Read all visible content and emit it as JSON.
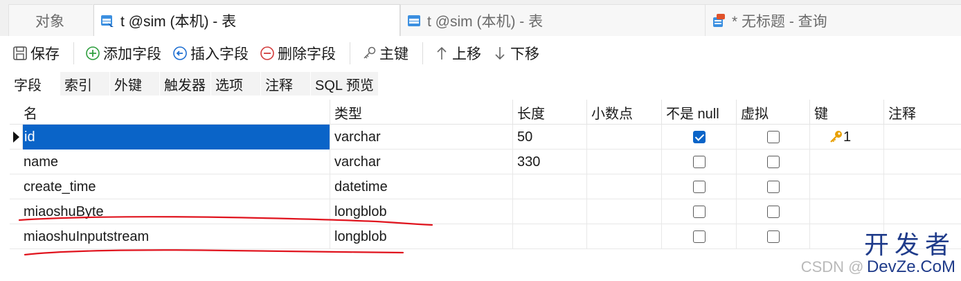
{
  "doc_tabs": {
    "objects_label": "对象",
    "tabs": [
      {
        "label": "t @sim (本机) - 表"
      },
      {
        "label": "t @sim (本机) - 表"
      },
      {
        "label": "* 无标题 - 查询"
      }
    ]
  },
  "toolbar": {
    "save": "保存",
    "add_field": "添加字段",
    "insert_field": "插入字段",
    "delete_field": "删除字段",
    "primary_key": "主键",
    "move_up": "上移",
    "move_down": "下移"
  },
  "sub_tabs": [
    "字段",
    "索引",
    "外键",
    "触发器",
    "选项",
    "注释",
    "SQL 预览"
  ],
  "grid": {
    "columns": [
      "名",
      "类型",
      "长度",
      "小数点",
      "不是 null",
      "虚拟",
      "键",
      "注释"
    ],
    "rows": [
      {
        "name": "id",
        "type": "varchar",
        "length": "50",
        "decimal": "",
        "not_null": true,
        "virtual": false,
        "key": "1",
        "comment": ""
      },
      {
        "name": "name",
        "type": "varchar",
        "length": "330",
        "decimal": "",
        "not_null": false,
        "virtual": false,
        "key": "",
        "comment": ""
      },
      {
        "name": "create_time",
        "type": "datetime",
        "length": "",
        "decimal": "",
        "not_null": false,
        "virtual": false,
        "key": "",
        "comment": ""
      },
      {
        "name": "miaoshuByte",
        "type": "longblob",
        "length": "",
        "decimal": "",
        "not_null": false,
        "virtual": false,
        "key": "",
        "comment": ""
      },
      {
        "name": "miaoshuInputstream",
        "type": "longblob",
        "length": "",
        "decimal": "",
        "not_null": false,
        "virtual": false,
        "key": "",
        "comment": ""
      }
    ]
  },
  "watermark": {
    "cn": "开发者",
    "csdn": "CSDN @",
    "dev": "DevZe.CoM"
  },
  "colors": {
    "selection": "#0a64c8",
    "annotation": "#e0141e",
    "key": "#e8a000"
  },
  "icons": [
    "table-icon",
    "query-icon",
    "save-icon",
    "add-icon",
    "insert-icon",
    "delete-icon",
    "key-icon",
    "arrow-up-icon",
    "arrow-down-icon"
  ]
}
